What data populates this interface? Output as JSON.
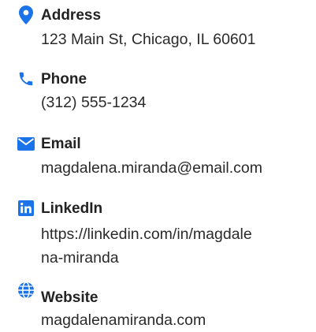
{
  "accent_color": "#1a73e8",
  "contact": {
    "items": [
      {
        "icon": "location-pin-icon",
        "label": "Address",
        "value": "123 Main St, Chicago, IL 60601"
      },
      {
        "icon": "phone-icon",
        "label": "Phone",
        "value": "(312) 555-1234"
      },
      {
        "icon": "envelope-icon",
        "label": "Email",
        "value": "magdalena.miranda@email.com"
      },
      {
        "icon": "linkedin-icon",
        "label": "LinkedIn",
        "value_line1": "https://linkedin.com/in/magdale",
        "value_line2": "na-miranda"
      },
      {
        "icon": "globe-icon",
        "label": "Website",
        "value": "magdalenamiranda.com"
      }
    ]
  }
}
